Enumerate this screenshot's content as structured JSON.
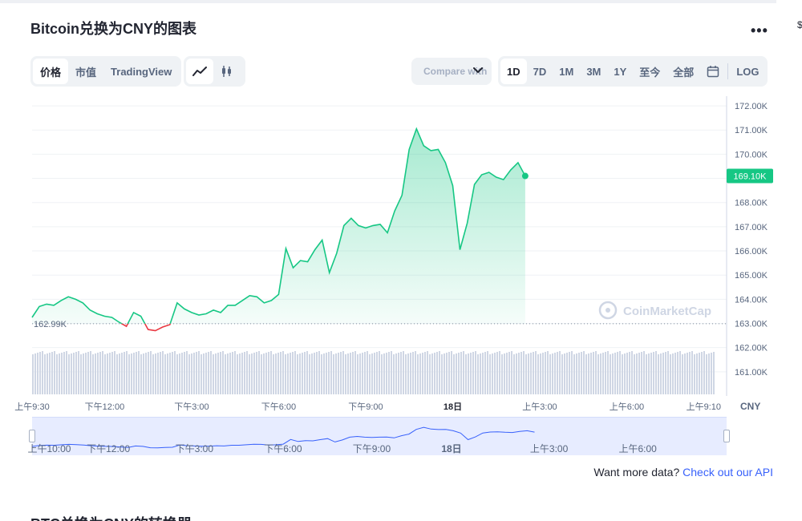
{
  "title": "Bitcoin兑换为CNY的图表",
  "header_icons": {
    "more": "more-horizontal-icon"
  },
  "tabs": [
    {
      "label": "价格",
      "active": true
    },
    {
      "label": "市值",
      "active": false
    },
    {
      "label": "TradingView",
      "active": false
    }
  ],
  "chart_type_buttons": [
    {
      "icon": "line-chart-icon",
      "active": true
    },
    {
      "icon": "candlestick-icon",
      "active": false
    }
  ],
  "compare": {
    "label": "Compare with"
  },
  "ranges": [
    {
      "label": "1D",
      "active": true
    },
    {
      "label": "7D",
      "active": false
    },
    {
      "label": "1M",
      "active": false
    },
    {
      "label": "3M",
      "active": false
    },
    {
      "label": "1Y",
      "active": false
    },
    {
      "label": "至今",
      "active": false
    },
    {
      "label": "全部",
      "active": false
    },
    {
      "icon": "calendar-icon"
    },
    {
      "label": "LOG",
      "active": false
    }
  ],
  "colors": {
    "up": "#16c784",
    "down": "#ea3943",
    "nav_line": "#3861fb",
    "grid": "#eff2f5",
    "axis_text": "#58667e"
  },
  "watermark": "CoinMarketCap",
  "chart_data": {
    "type": "area",
    "currency": "CNY",
    "baseline": 162.99,
    "baseline_label": "162.99K",
    "current_label": "169.10K",
    "y_unit": "K CNY",
    "ylim": [
      160,
      172.4
    ],
    "yticks": [
      "172.00K",
      "171.00K",
      "170.00K",
      "169.00K",
      "168.00K",
      "167.00K",
      "166.00K",
      "165.00K",
      "164.00K",
      "163.00K",
      "162.00K",
      "161.00K"
    ],
    "ytick_values": [
      172,
      171,
      170,
      169,
      168,
      167,
      166,
      165,
      164,
      163,
      162,
      161
    ],
    "x_hours": [
      0,
      0.25,
      0.5,
      0.75,
      1,
      1.25,
      1.5,
      1.75,
      2,
      2.25,
      2.5,
      2.75,
      3,
      3.25,
      3.5,
      3.75,
      4,
      4.25,
      4.5,
      4.75,
      5,
      5.25,
      5.5,
      5.75,
      6,
      6.25,
      6.5,
      6.75,
      7,
      7.25,
      7.5,
      7.75,
      8,
      8.25,
      8.5,
      8.75,
      9,
      9.25,
      9.5,
      9.75,
      10,
      10.25,
      10.5,
      10.75,
      11,
      11.25,
      11.5,
      11.75,
      12,
      12.25,
      12.5,
      12.75,
      13,
      13.25,
      13.5,
      13.75,
      14,
      14.25,
      14.5,
      14.75,
      15,
      15.25,
      15.5,
      15.75,
      16,
      16.25,
      16.5,
      16.75,
      17,
      17.25,
      17.5,
      17.75,
      18,
      18.25,
      18.5,
      18.75,
      19,
      19.25,
      19.5,
      19.75,
      20,
      20.25,
      20.5,
      20.75,
      21,
      21.25,
      21.5,
      21.75,
      22,
      22.25,
      22.5,
      22.75,
      23,
      23.25,
      23.5
    ],
    "values": [
      163.25,
      163.7,
      163.8,
      163.75,
      163.95,
      164.1,
      164.0,
      163.85,
      163.55,
      163.4,
      163.3,
      163.25,
      163.05,
      162.88,
      163.45,
      163.3,
      162.75,
      162.7,
      162.85,
      162.95,
      163.85,
      163.6,
      163.45,
      163.35,
      163.4,
      163.55,
      163.45,
      163.75,
      163.75,
      163.95,
      164.15,
      164.1,
      163.85,
      163.95,
      164.2,
      166.1,
      165.3,
      165.6,
      165.55,
      166.05,
      166.45,
      165.1,
      165.9,
      167.05,
      167.35,
      167.05,
      166.95,
      167.05,
      167.1,
      166.75,
      167.65,
      168.3,
      170.2,
      171.05,
      170.35,
      170.15,
      170.2,
      169.65,
      168.7,
      166.05,
      167.15,
      168.75,
      169.15,
      169.25,
      169.05,
      168.95,
      169.35,
      169.65,
      169.1
    ],
    "x_tick_labels": [
      "上午9:30",
      "下午12:00",
      "下午3:00",
      "下午6:00",
      "下午9:00",
      "18日",
      "上午3:00",
      "上午6:00",
      "上午9:10"
    ],
    "x_tick_hours": [
      0,
      2.5,
      5.5,
      8.5,
      11.5,
      14.5,
      17.5,
      20.5,
      23.15
    ],
    "volume": {
      "label": "CNY"
    },
    "navigator": {
      "labels": [
        "上午10:00",
        "下午12:00",
        "下午3:00",
        "下午6:00",
        "下午9:00",
        "18日",
        "上午3:00",
        "上午6:00"
      ],
      "label_hours": [
        0.5,
        2.5,
        5.5,
        8.5,
        11.5,
        14.5,
        17.5,
        20.5
      ]
    }
  },
  "api_prompt": {
    "text": "Want more data?",
    "link": "Check out our API"
  },
  "next_section_title": "BTC兑换为CNY的转换器"
}
